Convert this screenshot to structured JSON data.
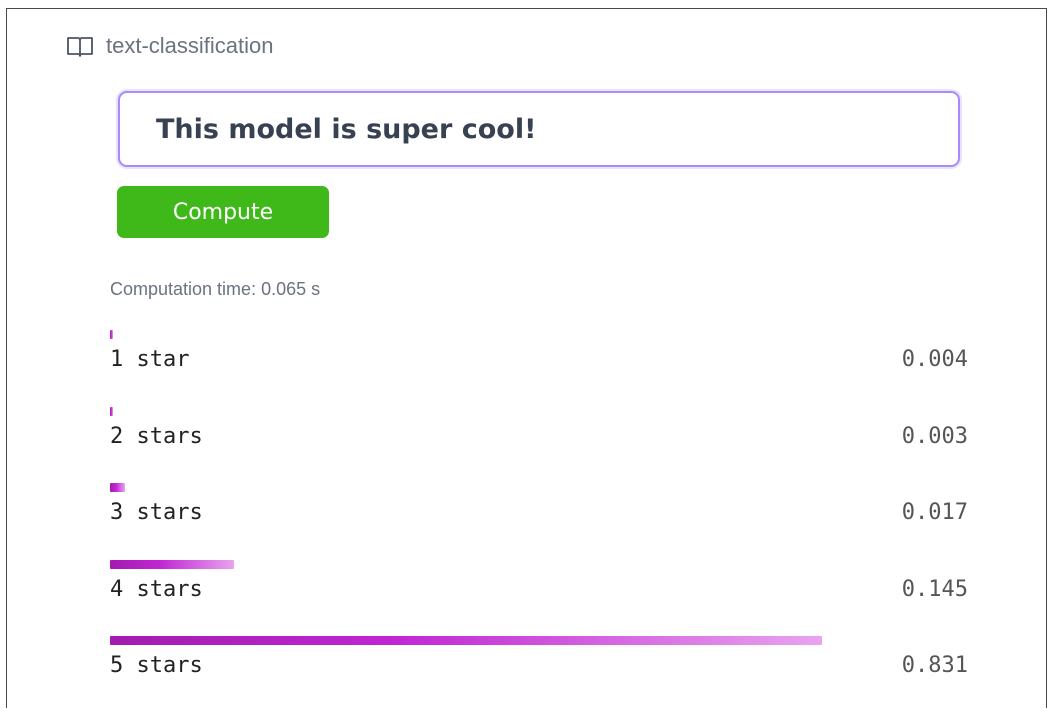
{
  "task": {
    "icon": "book-icon",
    "label": "text-classification"
  },
  "input": {
    "value": "This model is super cool!"
  },
  "compute_button": {
    "label": "Compute",
    "color": "#3fb91a"
  },
  "computation_time": "Computation time: 0.065 s",
  "results": [
    {
      "label": "1 star",
      "score": "0.004",
      "value": 0.004
    },
    {
      "label": "2 stars",
      "score": "0.003",
      "value": 0.003
    },
    {
      "label": "3 stars",
      "score": "0.017",
      "value": 0.017
    },
    {
      "label": "4 stars",
      "score": "0.145",
      "value": 0.145
    },
    {
      "label": "5 stars",
      "score": "0.831",
      "value": 0.831
    }
  ],
  "colors": {
    "bar": "#a21caf",
    "input_border": "#a78bfa"
  }
}
